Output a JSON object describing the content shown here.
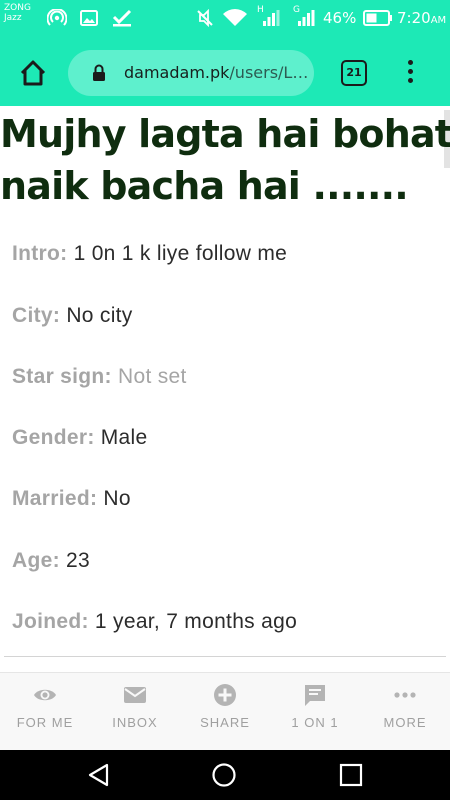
{
  "status_bar": {
    "carrier_line1": "ZONG",
    "carrier_line2": "Jazz",
    "network_h": "H",
    "network_g": "G",
    "battery": "46%",
    "time": "7:20",
    "time_suffix": "AM",
    "icons": [
      "hotspot-icon",
      "gallery-icon",
      "check-icon",
      "mute-icon",
      "wifi-icon",
      "signal-icon",
      "battery-icon"
    ]
  },
  "browser": {
    "home_icon": "home-icon",
    "lock_icon": "lock-icon",
    "url_domain": "damadam.pk",
    "url_path": "/users/L…",
    "tab_count": "21",
    "menu_icon": "more-vert-icon"
  },
  "page": {
    "title": "Mujhy lagta hai bohat naik bacha hai .......",
    "fields": [
      {
        "label": "Intro:",
        "value": "1 0n 1 k liye follow me"
      },
      {
        "label": "City:",
        "value": "No city"
      },
      {
        "label": "Star sign:",
        "value": "Not set"
      },
      {
        "label": "Gender:",
        "value": "Male"
      },
      {
        "label": "Married:",
        "value": "No"
      },
      {
        "label": "Age:",
        "value": "23"
      },
      {
        "label": "Joined:",
        "value": "1 year, 7 months ago"
      }
    ]
  },
  "bottom_nav": {
    "items": [
      {
        "label": "FOR ME",
        "icon": "eye-icon"
      },
      {
        "label": "INBOX",
        "icon": "mail-icon"
      },
      {
        "label": "SHARE",
        "icon": "add-circle-icon"
      },
      {
        "label": "1 ON 1",
        "icon": "chat-icon"
      },
      {
        "label": "MORE",
        "icon": "more-horiz-icon"
      }
    ]
  },
  "colors": {
    "accent": "#1de9b6",
    "title": "#0f2d0f",
    "label": "#a5a5a5",
    "nav_label": "#a0a0a0"
  }
}
